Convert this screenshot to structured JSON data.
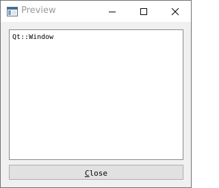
{
  "window": {
    "title": "Preview"
  },
  "titlebar": {
    "app_icon": "qt-app-window-icon",
    "minimize_icon": "minimize-icon",
    "maximize_icon": "maximize-icon",
    "close_icon": "close-icon"
  },
  "content": {
    "text": "Qt::Window"
  },
  "close_button": {
    "mnemonic": "C",
    "rest": "lose"
  },
  "colors": {
    "title_text": "#9a9a9a",
    "window_background": "#f0f0f0",
    "button_background": "#e1e1e1",
    "button_border": "#adadad",
    "content_border": "#828790"
  }
}
